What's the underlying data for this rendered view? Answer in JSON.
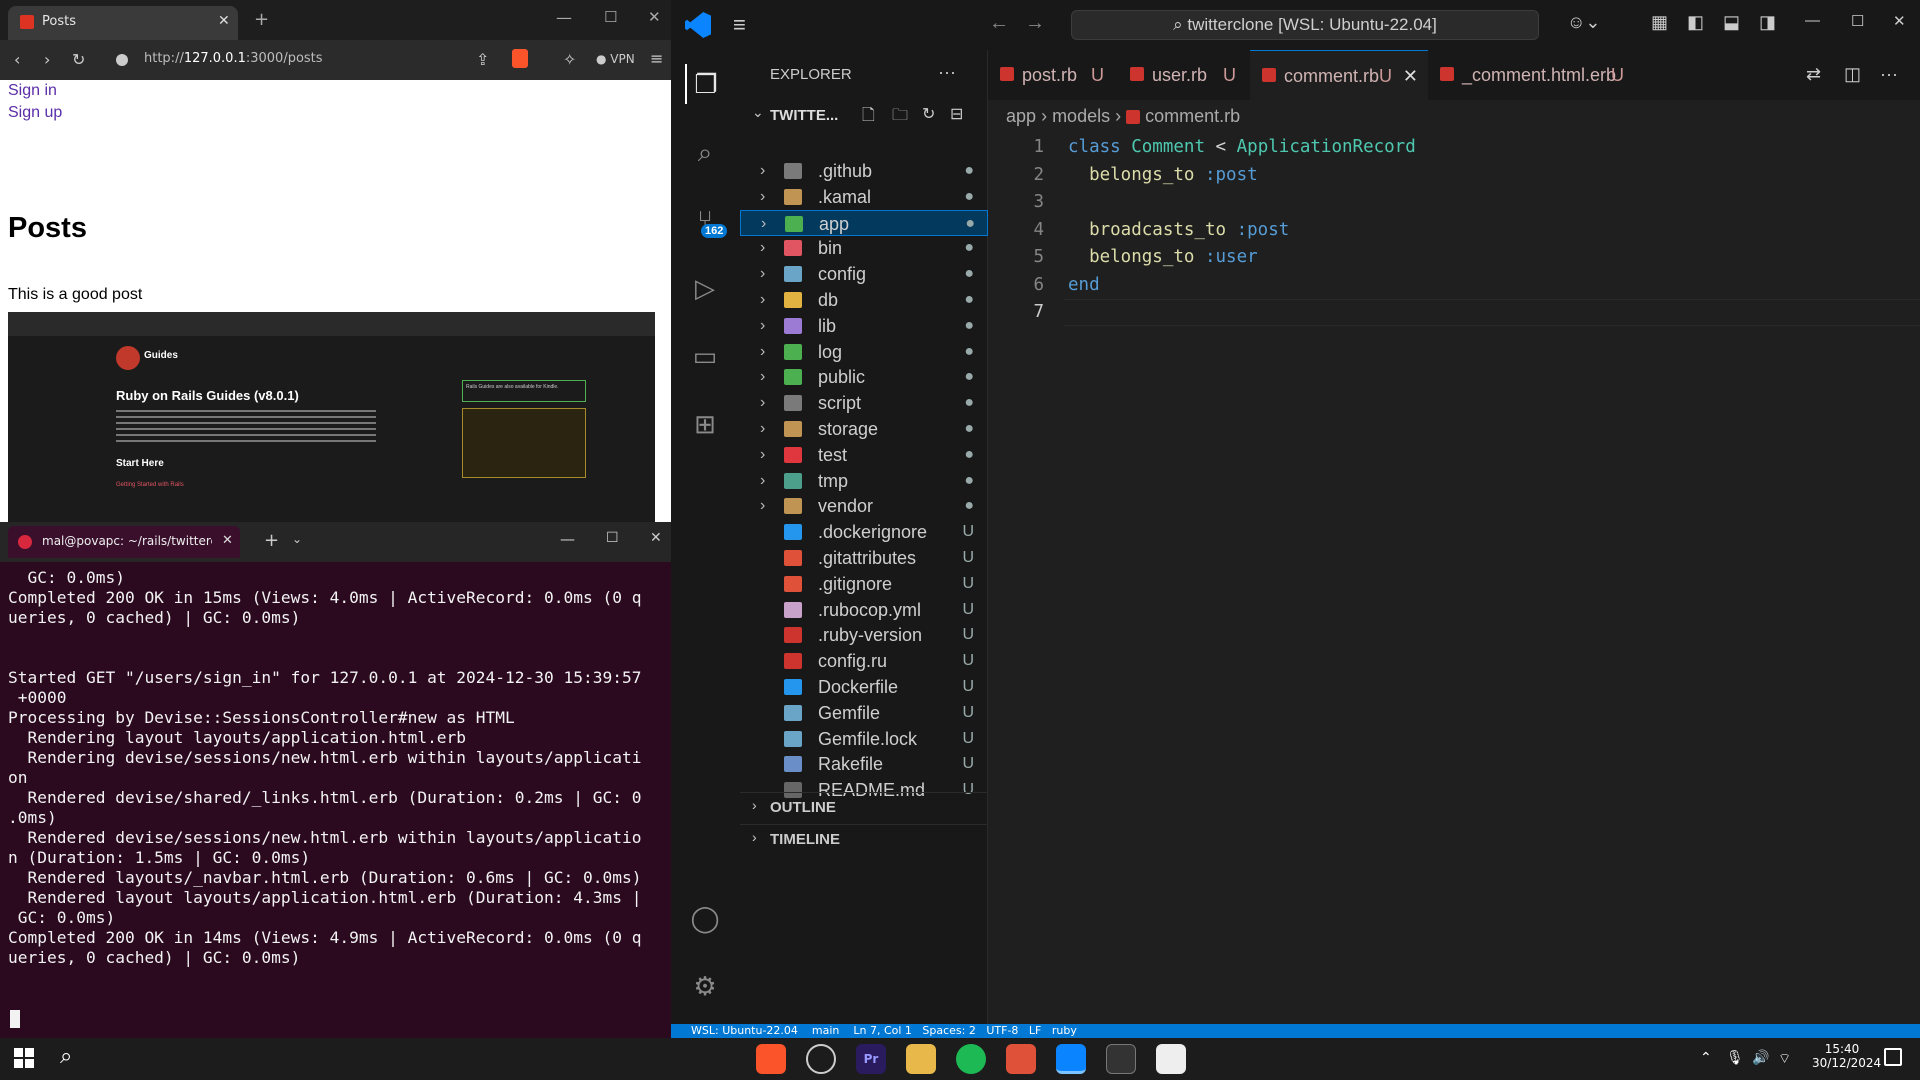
{
  "browser": {
    "tab_title": "Posts",
    "url_prefix": "http://",
    "url_host": "127.0.0.1",
    "url_path": ":3000/posts",
    "vpn_label": "VPN",
    "sign_in": "Sign in",
    "sign_up": "Sign up",
    "heading": "Posts",
    "post_body": "This is a good post",
    "embedded": {
      "brand": "Guides",
      "title": "Ruby on Rails Guides (v8.0.1)",
      "section": "Start Here",
      "link": "Getting Started with Rails",
      "note": "Rails Guides are also available for Kindle."
    }
  },
  "terminal": {
    "tab_title": "mal@povapc: ~/rails/twitterclo",
    "lines": [
      "  GC: 0.0ms)",
      "Completed 200 OK in 15ms (Views: 4.0ms | ActiveRecord: 0.0ms (0 q",
      "ueries, 0 cached) | GC: 0.0ms)",
      "",
      "",
      "Started GET \"/users/sign_in\" for 127.0.0.1 at 2024-12-30 15:39:57",
      " +0000",
      "Processing by Devise::SessionsController#new as HTML",
      "  Rendering layout layouts/application.html.erb",
      "  Rendering devise/sessions/new.html.erb within layouts/applicati",
      "on",
      "  Rendered devise/shared/_links.html.erb (Duration: 0.2ms | GC: 0",
      ".0ms)",
      "  Rendered devise/sessions/new.html.erb within layouts/applicatio",
      "n (Duration: 1.5ms | GC: 0.0ms)",
      "  Rendered layouts/_navbar.html.erb (Duration: 0.6ms | GC: 0.0ms)",
      "  Rendered layout layouts/application.html.erb (Duration: 4.3ms |",
      " GC: 0.0ms)",
      "Completed 200 OK in 14ms (Views: 4.9ms | ActiveRecord: 0.0ms (0 q",
      "ueries, 0 cached) | GC: 0.0ms)"
    ]
  },
  "vscode": {
    "search_text": "twitterclone [WSL: Ubuntu-22.04]",
    "scm_badge": "162",
    "explorer_title": "EXPLORER",
    "root_folder": "TWITTE...",
    "tree": [
      {
        "name": ".github",
        "status": "●",
        "folder": true,
        "color": "#7a7a7a"
      },
      {
        "name": ".kamal",
        "status": "●",
        "folder": true,
        "color": "#c09553"
      },
      {
        "name": "app",
        "status": "●",
        "folder": true,
        "color": "#4caf50"
      },
      {
        "name": "bin",
        "status": "●",
        "folder": true,
        "color": "#e05561"
      },
      {
        "name": "config",
        "status": "●",
        "folder": true,
        "color": "#6aa5c8"
      },
      {
        "name": "db",
        "status": "●",
        "folder": true,
        "color": "#e3b341"
      },
      {
        "name": "lib",
        "status": "●",
        "folder": true,
        "color": "#9b7bd4"
      },
      {
        "name": "log",
        "status": "●",
        "folder": true,
        "color": "#4caf50"
      },
      {
        "name": "public",
        "status": "●",
        "folder": true,
        "color": "#4caf50"
      },
      {
        "name": "script",
        "status": "●",
        "folder": true,
        "color": "#7a7a7a"
      },
      {
        "name": "storage",
        "status": "●",
        "folder": true,
        "color": "#c09553"
      },
      {
        "name": "test",
        "status": "●",
        "folder": true,
        "color": "#e0373f"
      },
      {
        "name": "tmp",
        "status": "●",
        "folder": true,
        "color": "#4c9f8a"
      },
      {
        "name": "vendor",
        "status": "●",
        "folder": true,
        "color": "#c09553"
      },
      {
        "name": ".dockerignore",
        "status": "U",
        "folder": false,
        "color": "#2496ed"
      },
      {
        "name": ".gitattributes",
        "status": "U",
        "folder": false,
        "color": "#e0513a"
      },
      {
        "name": ".gitignore",
        "status": "U",
        "folder": false,
        "color": "#e0513a"
      },
      {
        "name": ".rubocop.yml",
        "status": "U",
        "folder": false,
        "color": "#c8a2c8"
      },
      {
        "name": ".ruby-version",
        "status": "U",
        "folder": false,
        "color": "#cc342d"
      },
      {
        "name": "config.ru",
        "status": "U",
        "folder": false,
        "color": "#cc342d"
      },
      {
        "name": "Dockerfile",
        "status": "U",
        "folder": false,
        "color": "#2496ed"
      },
      {
        "name": "Gemfile",
        "status": "U",
        "folder": false,
        "color": "#6aa5c8"
      },
      {
        "name": "Gemfile.lock",
        "status": "U",
        "folder": false,
        "color": "#6aa5c8"
      },
      {
        "name": "Rakefile",
        "status": "U",
        "folder": false,
        "color": "#6a8fc8"
      },
      {
        "name": "README.md",
        "status": "U",
        "folder": false,
        "color": "#666666"
      }
    ],
    "outline": "OUTLINE",
    "timeline": "TIMELINE",
    "tabs": [
      {
        "name": "post.rb",
        "status": "U"
      },
      {
        "name": "user.rb",
        "status": "U"
      },
      {
        "name": "comment.rb",
        "status": "U"
      },
      {
        "name": "_comment.html.erb",
        "status": "U"
      }
    ],
    "breadcrumb": [
      "app",
      "models",
      "comment.rb"
    ],
    "code_lines": [
      "1",
      "2",
      "3",
      "4",
      "5",
      "6",
      "7"
    ],
    "status_text": "WSL: Ubuntu-22.04    main    Ln 7, Col 1   Spaces: 2   UTF-8   LF   ruby"
  },
  "taskbar": {
    "time": "15:40",
    "date": "30/12/2024"
  }
}
